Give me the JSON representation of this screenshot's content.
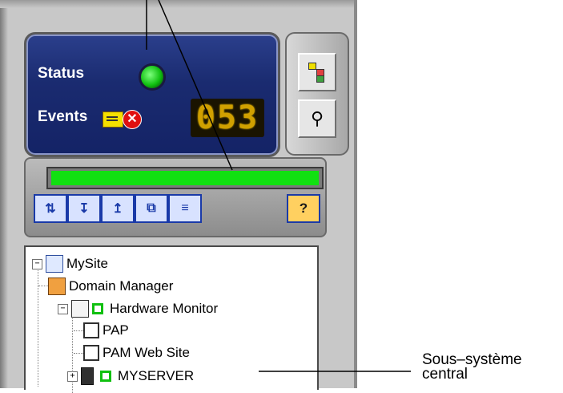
{
  "status_panel": {
    "status_label": "Status",
    "events_label": "Events",
    "event_counter": "053"
  },
  "colors": {
    "status_ok": "#10c010",
    "progress_fill": "#11e011",
    "panel_bg": "#1a2b70"
  },
  "side_buttons": [
    {
      "icon": "tree-view-icon"
    },
    {
      "icon": "binoculars-icon"
    }
  ],
  "progress": {
    "value": 1.0
  },
  "toolbar": {
    "buttons": [
      {
        "icon": "refresh-icon",
        "glyph": "⇅"
      },
      {
        "icon": "expand-all-icon",
        "glyph": "↧"
      },
      {
        "icon": "collapse-all-icon",
        "glyph": "↥"
      },
      {
        "icon": "network-icon",
        "glyph": "⧉"
      },
      {
        "icon": "stack-icon",
        "glyph": "≡"
      }
    ],
    "help_glyph": "?"
  },
  "tree": {
    "root": "MySite",
    "items": [
      {
        "label": "Domain Manager"
      },
      {
        "label": "Hardware Monitor"
      },
      {
        "label": "PAP"
      },
      {
        "label": "PAM Web Site"
      },
      {
        "label": "MYSERVER"
      }
    ]
  },
  "callout": {
    "line1": "Sous–système",
    "line2": "central"
  }
}
